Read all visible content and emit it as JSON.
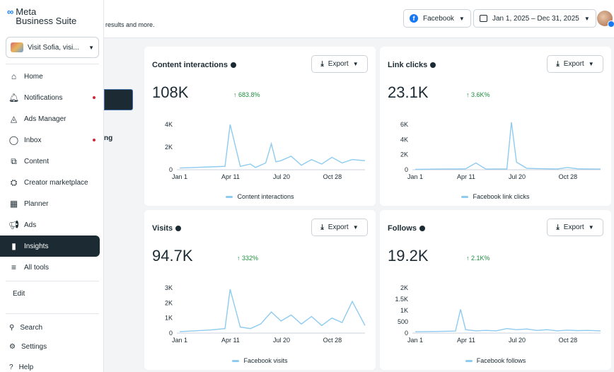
{
  "brand": {
    "logo": "∞",
    "name_line1": "Meta",
    "name_line2": "Business Suite"
  },
  "account": {
    "label": "Visit Sofia, visi..."
  },
  "nav": [
    {
      "label": "Home",
      "icon": "home-icon",
      "glyph": "⌂"
    },
    {
      "label": "Notifications",
      "icon": "bell-icon",
      "glyph": "🔔︎",
      "dot": true
    },
    {
      "label": "Ads Manager",
      "icon": "ads-manager-icon",
      "glyph": "◬"
    },
    {
      "label": "Inbox",
      "icon": "inbox-icon",
      "glyph": "◯",
      "dot": true
    },
    {
      "label": "Content",
      "icon": "content-icon",
      "glyph": "⧉"
    },
    {
      "label": "Creator marketplace",
      "icon": "handshake-icon",
      "glyph": "⛭"
    },
    {
      "label": "Planner",
      "icon": "calendar-icon",
      "glyph": "▦"
    },
    {
      "label": "Ads",
      "icon": "megaphone-icon",
      "glyph": "📢︎"
    },
    {
      "label": "Insights",
      "icon": "bar-chart-icon",
      "glyph": "▮",
      "active": true
    },
    {
      "label": "All tools",
      "icon": "menu-icon",
      "glyph": "≡"
    }
  ],
  "edit_label": "Edit",
  "search_label": "Search",
  "settings_label": "Settings",
  "help_label": "Help",
  "background_hint": "results and more.",
  "background_fragment": "ng",
  "topbar": {
    "platform": "Facebook",
    "date_range": "Jan 1, 2025 – Dec 31, 2025"
  },
  "export_label": "Export",
  "cards": [
    {
      "title": "Content interactions",
      "value": "108K",
      "delta": "↑ 683.8%",
      "legend": "Content interactions"
    },
    {
      "title": "Link clicks",
      "value": "23.1K",
      "delta": "↑ 3.6K%",
      "legend": "Facebook link clicks"
    },
    {
      "title": "Visits",
      "value": "94.7K",
      "delta": "↑ 332%",
      "legend": "Facebook visits"
    },
    {
      "title": "Follows",
      "value": "19.2K",
      "delta": "↑ 2.1K%",
      "legend": "Facebook follows"
    }
  ],
  "chart_data": [
    {
      "type": "line",
      "series_name": "Content interactions",
      "ylim": [
        0,
        4000
      ],
      "yticks": [
        "0",
        "2K",
        "4K"
      ],
      "xticks": [
        "Jan 1",
        "Apr 11",
        "Jul 20",
        "Oct 28"
      ],
      "color": "#8ecbef",
      "x": [
        1,
        30,
        60,
        90,
        100,
        120,
        140,
        150,
        170,
        181,
        190,
        200,
        220,
        240,
        260,
        280,
        300,
        320,
        340,
        365
      ],
      "y": [
        150,
        200,
        250,
        300,
        4000,
        300,
        500,
        200,
        600,
        2300,
        700,
        800,
        1200,
        400,
        900,
        500,
        1100,
        600,
        900,
        800
      ]
    },
    {
      "type": "line",
      "series_name": "Facebook link clicks",
      "ylim": [
        0,
        6000
      ],
      "yticks": [
        "0",
        "2K",
        "4K",
        "6K"
      ],
      "xticks": [
        "Jan 1",
        "Apr 11",
        "Jul 20",
        "Oct 28"
      ],
      "color": "#8ecbef",
      "x": [
        1,
        40,
        80,
        100,
        120,
        140,
        160,
        181,
        190,
        200,
        220,
        240,
        260,
        280,
        300,
        320,
        340,
        365
      ],
      "y": [
        50,
        80,
        100,
        120,
        900,
        80,
        100,
        100,
        6300,
        1000,
        200,
        150,
        120,
        100,
        300,
        120,
        100,
        80
      ]
    },
    {
      "type": "line",
      "series_name": "Facebook visits",
      "ylim": [
        0,
        3000
      ],
      "yticks": [
        "0",
        "1K",
        "2K",
        "3K"
      ],
      "xticks": [
        "Jan 1",
        "Apr 11",
        "Jul 20",
        "Oct 28"
      ],
      "color": "#8ecbef",
      "x": [
        1,
        30,
        60,
        90,
        100,
        120,
        140,
        160,
        181,
        200,
        220,
        240,
        260,
        280,
        300,
        320,
        340,
        365
      ],
      "y": [
        100,
        150,
        200,
        300,
        2900,
        400,
        300,
        600,
        1400,
        800,
        1200,
        600,
        1100,
        500,
        1000,
        700,
        2100,
        500
      ]
    },
    {
      "type": "line",
      "series_name": "Facebook follows",
      "ylim": [
        0,
        2000
      ],
      "yticks": [
        "0",
        "500",
        "1K",
        "1.5K",
        "2K"
      ],
      "xticks": [
        "Jan 1",
        "Apr 11",
        "Jul 20",
        "Oct 28"
      ],
      "color": "#8ecbef",
      "x": [
        1,
        30,
        60,
        80,
        90,
        100,
        120,
        140,
        160,
        181,
        200,
        220,
        240,
        260,
        280,
        300,
        320,
        340,
        365
      ],
      "y": [
        60,
        70,
        80,
        90,
        1050,
        150,
        100,
        120,
        100,
        200,
        150,
        180,
        120,
        150,
        100,
        130,
        110,
        120,
        100
      ]
    }
  ]
}
